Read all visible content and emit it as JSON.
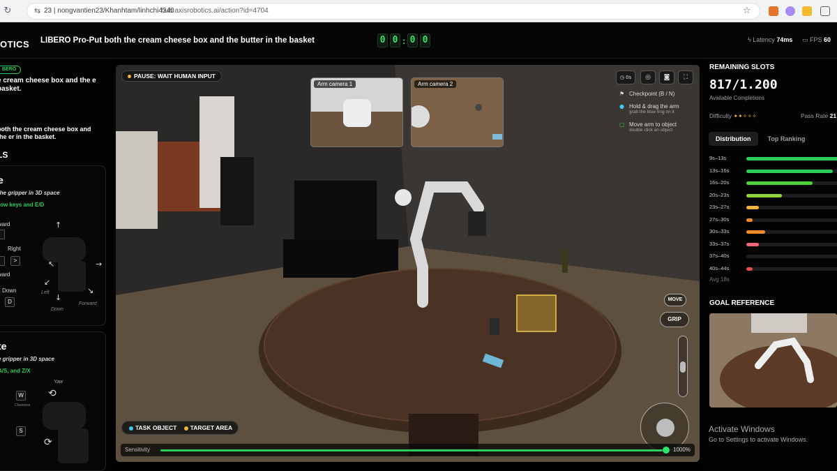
{
  "browser": {
    "host": "23 | nongvantien23/Khanhtam/linhchi4340",
    "url": "hub.axisrobotics.ai/action?id=4704"
  },
  "header": {
    "brand": "OTICS",
    "title": "LIBERO Pro-Put both the cream cheese box and the butter in the basket",
    "timer": [
      "0",
      "0",
      "0",
      "0"
    ],
    "latency_label": "Latency",
    "latency_value": "74ms",
    "fps_label": "FPS",
    "fps_value": "60"
  },
  "left_panel": {
    "badge": "BERO",
    "desc1": "e cream cheese box and the e basket.",
    "desc2": "both the cream cheese box and the er in the basket.",
    "section": "LS",
    "move_card": {
      "title": "e",
      "subtitle": "the gripper in 3D space",
      "keys": "row keys and E/D",
      "labels": {
        "forward": "ward",
        "right": "Right",
        "backward": "ward",
        "down": "Down"
      },
      "key_right": ">",
      "key_d": "D",
      "dir_left": "Left",
      "dir_down": "Down",
      "dir_forward": "Forward"
    },
    "rotate_card": {
      "title": "te",
      "subtitle": "e gripper in 3D space",
      "keys": "A/S, and Z/X",
      "yaw": "Yaw",
      "key_w": "W",
      "key_s": "S",
      "clockwise": "Clockwise"
    }
  },
  "viewport": {
    "status": "PAUSE: WAIT HUMAN INPUT",
    "cam1": "Arm camera 1",
    "cam2": "Arm camera 2",
    "timer_btn": "0s",
    "hints": [
      {
        "title": "Checkpoint (B / N)",
        "sub": ""
      },
      {
        "title": "Hold & drag the arm",
        "sub": "grab the blue ring on it"
      },
      {
        "title": "Move arm to object",
        "sub": "double click an object"
      }
    ],
    "legend_task": "TASK OBJECT",
    "legend_target": "TARGET AREA",
    "move_btn": "MOVE",
    "grip_btn": "GRIP",
    "sensitivity_label": "Sensitivity",
    "sensitivity_value": "1000%",
    "sensitivity_fraction": 0.96
  },
  "right_panel": {
    "slots_title": "REMAINING SLOTS",
    "slots_count": "817/1.200",
    "slots_sub": "Available Completions",
    "difficulty_label": "Difficulty",
    "difficulty_stars": "✦✦✧✧✧",
    "pass_label": "Pass Rate",
    "pass_value": "21",
    "tabs": [
      "Distribution",
      "Top Ranking"
    ],
    "distribution": [
      {
        "label": "9s–13s",
        "value": 1.0,
        "color": "#2ecc5a"
      },
      {
        "label": "13s–16s",
        "value": 0.92,
        "color": "#2ecc5a"
      },
      {
        "label": "16s–20s",
        "value": 0.7,
        "color": "#4cd137"
      },
      {
        "label": "20s–23s",
        "value": 0.38,
        "color": "#8fd43a"
      },
      {
        "label": "23s–27s",
        "value": 0.13,
        "color": "#f2b33d"
      },
      {
        "label": "27s–30s",
        "value": 0.07,
        "color": "#f28c28"
      },
      {
        "label": "30s–33s",
        "value": 0.2,
        "color": "#f28c28"
      },
      {
        "label": "33s–37s",
        "value": 0.13,
        "color": "#f0657a"
      },
      {
        "label": "37s–40s",
        "value": 0.0,
        "color": "#e84a4a"
      },
      {
        "label": "40s–44s",
        "value": 0.07,
        "color": "#e84a4a"
      }
    ],
    "avg": "Avg 18s",
    "goal_title": "GOAL REFERENCE",
    "activate_title": "Activate Windows",
    "activate_sub": "Go to Settings to activate Windows."
  },
  "colors": {
    "accent": "#2ecc5a",
    "timer": "#2ee66b",
    "task_object": "#3fc8f0",
    "target_area": "#f2b33d"
  }
}
